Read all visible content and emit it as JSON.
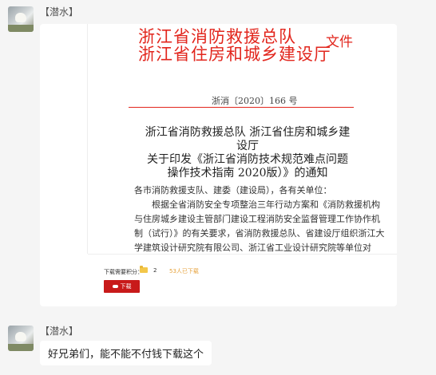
{
  "messages": [
    {
      "sender": "【潜水】",
      "doc": {
        "header_line1": "浙江省消防救援总队",
        "header_line2": "浙江省住房和城乡建设厅",
        "header_suffix": "文件",
        "doc_number": "浙消〔2020〕166 号",
        "title_line1": "浙江省消防救援总队 浙江省住房和城乡建设厅",
        "title_line2": "关于印发《浙江省消防技术规范难点问题",
        "title_line3": "操作技术指南 2020版）》的通知",
        "salutation": "各市消防救援支队、建委（建设局），各有关单位：",
        "body_line1": "根据全省消防安全专项整治三年行动方案和《消防救援机构",
        "body_line2": "与住房城乡建设主管部门建设工程消防安全监督管理工作协作机",
        "body_line3": "制（试行）》的有关要求，省消防救援总队、省建设厅组织浙江大",
        "body_line4": "学建筑设计研究院有限公司、浙江省工业设计研究院等单位对"
      },
      "download": {
        "points_label": "下载需要积分：",
        "points_value": "2",
        "downloaded_count": "53人已下载",
        "button_label": "下载"
      }
    },
    {
      "sender": "【潜水】",
      "text": "好兄弟们，能不能不付钱下载这个"
    }
  ]
}
